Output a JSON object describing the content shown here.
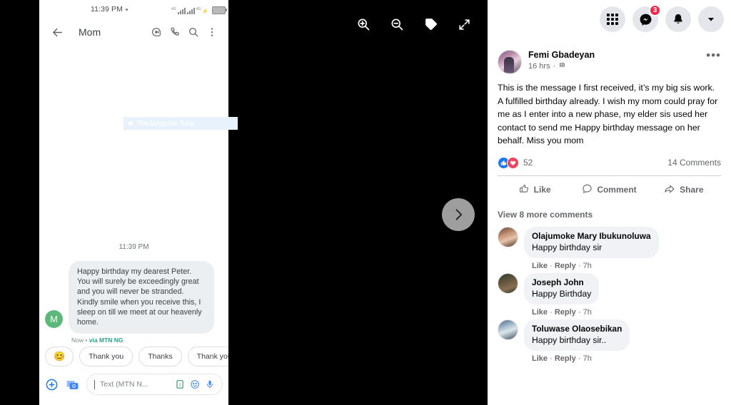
{
  "viewer": {
    "toolbar": [
      {
        "name": "zoom-in-icon",
        "label": "Zoom in"
      },
      {
        "name": "zoom-out-icon",
        "label": "Zoom out"
      },
      {
        "name": "tag-icon",
        "label": "Tag photo"
      },
      {
        "name": "fullscreen-icon",
        "label": "Enter fullscreen"
      }
    ],
    "next_label": "Next photo"
  },
  "snip": {
    "label": "Rectangular Snip"
  },
  "phone": {
    "status": {
      "time": "11:39 PM",
      "network_label": "4G",
      "network_label2": "4G"
    },
    "header": {
      "title": "Mom",
      "icons": [
        "back-arrow-icon",
        "video-call-icon",
        "phone-call-icon",
        "search-icon",
        "overflow-menu-icon"
      ]
    },
    "conversation": {
      "timestamp": "11:39 PM",
      "avatar_initial": "M",
      "message": "Happy birthday my dearest Peter. You will surely be exceedingly great and you will never be stranded. Kindly smile when you receive this, I sleep on till we meet at our heavenly home.",
      "meta_time": "Now",
      "meta_sep": "•",
      "meta_via": "via",
      "meta_carrier": "MTN NG"
    },
    "chips": [
      {
        "type": "emoji",
        "label": "😊"
      },
      {
        "type": "text",
        "label": "Thank you"
      },
      {
        "type": "text",
        "label": "Thanks"
      },
      {
        "type": "text",
        "label": "Thank you so m"
      }
    ],
    "input": {
      "placeholder": "Text (MTN N...",
      "icons": [
        "add-plus-icon",
        "image-picker-icon",
        "sim-select-icon",
        "emoji-icon",
        "microphone-icon"
      ]
    }
  },
  "facebook": {
    "topbar": {
      "menu_label": "Menu",
      "messenger_label": "Messenger",
      "messenger_badge": "3",
      "notifications_label": "Notifications",
      "account_label": "Account"
    },
    "post": {
      "author": "Femi Gbadeyan",
      "time": "16 hrs",
      "separator": "·",
      "audience": "Public",
      "menu_label": "Post options",
      "text": "This is the message I first received, it’s my big sis work. A fulfilled birthday already. I wish my mom could pray for me as I enter into a new phase, my elder sis used her contact to send me Happy birthday message on her behalf. Miss you mom",
      "reaction_count": "52",
      "comment_count": "14 Comments",
      "actions": [
        {
          "name": "like-button",
          "label": "Like",
          "icon": "thumbs-up-icon"
        },
        {
          "name": "comment-button",
          "label": "Comment",
          "icon": "comment-bubble-icon"
        },
        {
          "name": "share-button",
          "label": "Share",
          "icon": "share-arrow-icon"
        }
      ]
    },
    "comments": {
      "view_more": "View 8 more comments",
      "action_like": "Like",
      "action_reply": "Reply",
      "action_sep": "·",
      "items": [
        {
          "name": "Olajumoke Mary Ibukunoluwa",
          "text": "Happy birthday sir",
          "time": "7h"
        },
        {
          "name": "Joseph John",
          "text": "Happy Birthday",
          "time": "7h"
        },
        {
          "name": "Toluwase Olaosebikan",
          "text": "Happy birthday sir..",
          "time": "7h"
        }
      ]
    }
  },
  "colors": {
    "fb_blue": "#1877f2",
    "fb_red": "#f3425f",
    "badge_red": "#f02849",
    "carrier_green": "#2e9e85",
    "avatar_green": "#5cb87a"
  }
}
